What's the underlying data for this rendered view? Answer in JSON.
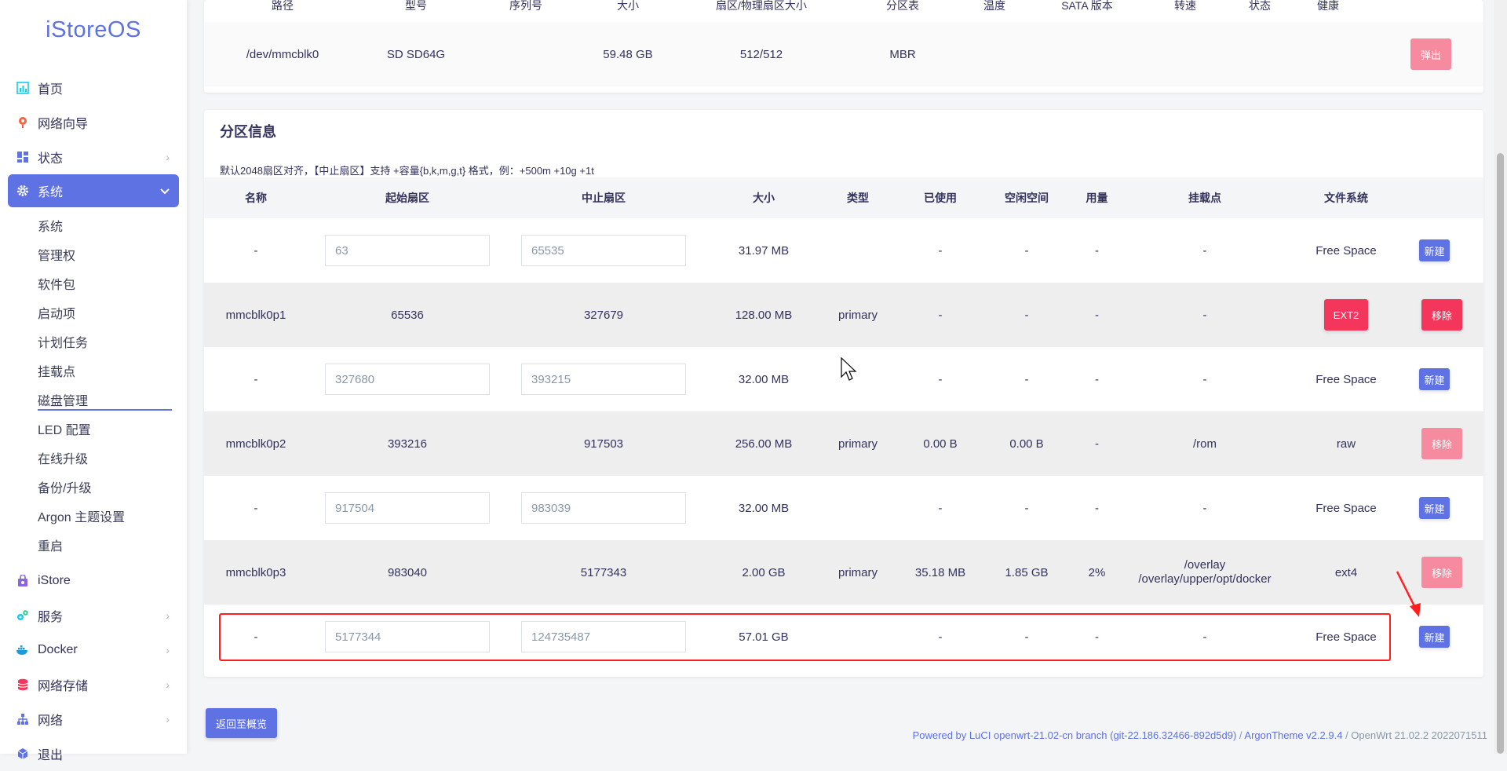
{
  "brand": "iStoreOS",
  "sidebar": {
    "items": [
      {
        "label": "首页",
        "icon": "chart-icon"
      },
      {
        "label": "网络向导",
        "icon": "wizard-icon"
      },
      {
        "label": "状态",
        "icon": "dashboard-icon"
      },
      {
        "label": "系统",
        "icon": "gear-icon"
      },
      {
        "label": "iStore",
        "icon": "store-icon"
      },
      {
        "label": "服务",
        "icon": "services-icon"
      },
      {
        "label": "Docker",
        "icon": "docker-icon"
      },
      {
        "label": "网络存储",
        "icon": "database-icon"
      },
      {
        "label": "网络",
        "icon": "network-icon"
      },
      {
        "label": "退出",
        "icon": "logout-icon"
      }
    ],
    "system_sub": [
      "系统",
      "管理权",
      "软件包",
      "启动项",
      "计划任务",
      "挂载点",
      "磁盘管理",
      "LED 配置",
      "在线升级",
      "备份/升级",
      "Argon 主题设置",
      "重启"
    ]
  },
  "disk_table": {
    "headers": [
      "路径",
      "型号",
      "序列号",
      "大小",
      "扇区/物理扇区大小",
      "分区表",
      "温度",
      "SATA 版本",
      "转速",
      "状态",
      "健康"
    ],
    "row": {
      "path": "/dev/mmcblk0",
      "model": "SD SD64G",
      "serial": "",
      "size": "59.48 GB",
      "sector": "512/512",
      "table": "MBR",
      "eject": "弹出"
    }
  },
  "partition": {
    "title": "分区信息",
    "note": "默认2048扇区对齐，【中止扇区】支持 +容量{b,k,m,g,t} 格式，例：+500m +10g +1t",
    "headers": [
      "名称",
      "起始扇区",
      "中止扇区",
      "大小",
      "类型",
      "已使用",
      "空闲空间",
      "用量",
      "挂载点",
      "文件系统"
    ],
    "rows": [
      {
        "name": "-",
        "start": "63",
        "end": "65535",
        "size": "31.97 MB",
        "type": "",
        "used": "-",
        "free": "-",
        "usage": "-",
        "mount": "-",
        "fs": "Free Space",
        "action": "新建"
      },
      {
        "name": "mmcblk0p1",
        "start": "65536",
        "end": "327679",
        "size": "128.00 MB",
        "type": "primary",
        "used": "-",
        "free": "-",
        "usage": "-",
        "mount": "-",
        "fs": "EXT2",
        "action": "移除"
      },
      {
        "name": "-",
        "start": "327680",
        "end": "393215",
        "size": "32.00 MB",
        "type": "",
        "used": "-",
        "free": "-",
        "usage": "-",
        "mount": "-",
        "fs": "Free Space",
        "action": "新建"
      },
      {
        "name": "mmcblk0p2",
        "start": "393216",
        "end": "917503",
        "size": "256.00 MB",
        "type": "primary",
        "used": "0.00 B",
        "free": "0.00 B",
        "usage": "-",
        "mount": "/rom",
        "fs": "raw",
        "action": "移除"
      },
      {
        "name": "-",
        "start": "917504",
        "end": "983039",
        "size": "32.00 MB",
        "type": "",
        "used": "-",
        "free": "-",
        "usage": "-",
        "mount": "-",
        "fs": "Free Space",
        "action": "新建"
      },
      {
        "name": "mmcblk0p3",
        "start": "983040",
        "end": "5177343",
        "size": "2.00 GB",
        "type": "primary",
        "used": "35.18 MB",
        "free": "1.85 GB",
        "usage": "2%",
        "mount": "/overlay",
        "mount2": "/overlay/upper/opt/docker",
        "fs": "ext4",
        "action": "移除"
      },
      {
        "name": "-",
        "start": "5177344",
        "end": "124735487",
        "size": "57.01 GB",
        "type": "",
        "used": "-",
        "free": "-",
        "usage": "-",
        "mount": "-",
        "fs": "Free Space",
        "action": "新建"
      }
    ]
  },
  "back_button": "返回至概览",
  "footer": {
    "luci": "Powered by LuCI openwrt-21.02-cn branch (git-22.186.32466-892d5d9)",
    "sep": " / ",
    "theme": "ArgonTheme v2.2.9.4",
    "version": " / OpenWrt 21.02.2 2022071511"
  },
  "colors": {
    "accent": "#5e72e4",
    "danger": "#f5365c",
    "highlight": "#ff1f1f"
  }
}
